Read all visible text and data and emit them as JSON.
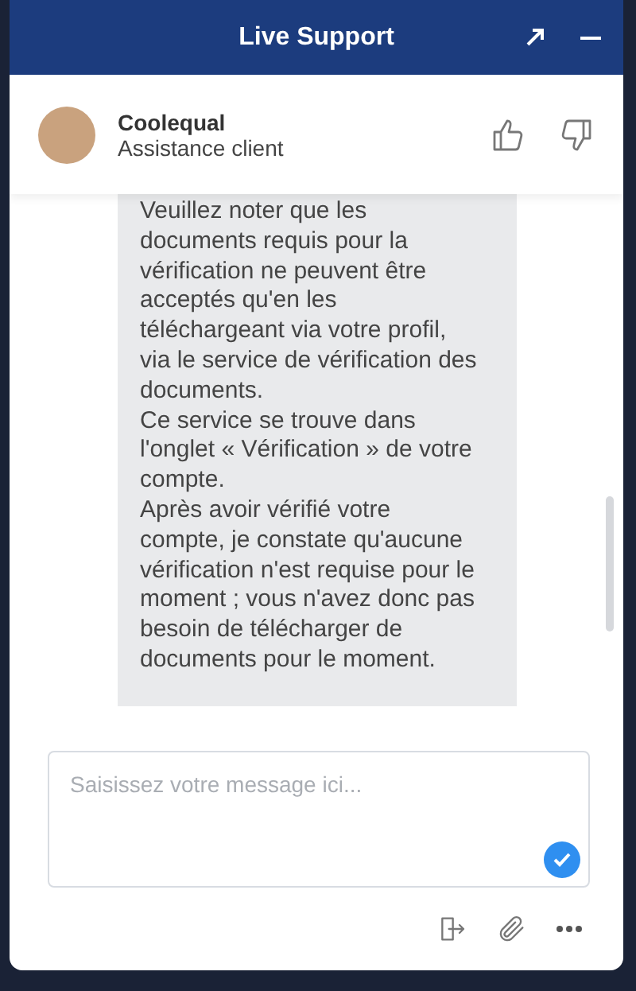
{
  "window": {
    "title": "Live Support"
  },
  "agent": {
    "name": "Coolequal",
    "role": "Assistance client"
  },
  "messages": [
    {
      "paragraphs": [
        "Veuillez noter que les documents requis pour la vérification ne peuvent être acceptés qu'en les téléchargeant via votre profil, via le service de vérification des documents.",
        "Ce service se trouve dans l'onglet « Vérification » de votre compte.",
        "Après avoir vérifié votre compte, je constate qu'aucune vérification n'est requise pour le moment ; vous n'avez donc pas besoin de télécharger de documents pour le moment."
      ]
    }
  ],
  "composer": {
    "placeholder": "Saisissez votre message ici..."
  }
}
